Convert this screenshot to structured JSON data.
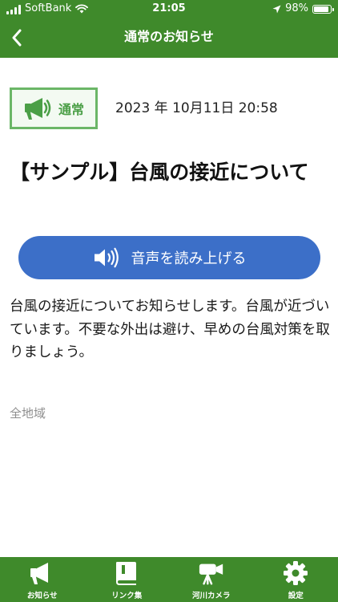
{
  "status_bar": {
    "carrier": "SoftBank",
    "time": "21:05",
    "battery": "98%",
    "battery_level": 0.98
  },
  "nav": {
    "back_icon": "chevron-left-icon",
    "title": "通常のお知らせ"
  },
  "notice": {
    "category_icon": "megaphone-icon",
    "category": "通常",
    "datetime": "2023 年 10月11日 20:58",
    "title": "【サンプル】台風の接近について",
    "read_aloud_icon": "speaker-icon",
    "read_aloud_label": "音声を読み上げる",
    "body": "台風の接近についてお知らせします。台風が近づいています。不要な外出は避け、早めの台風対策を取りましょう。",
    "area": "全地域"
  },
  "tabbar": {
    "items": [
      {
        "label": "お知らせ",
        "icon": "megaphone-icon"
      },
      {
        "label": "リンク集",
        "icon": "book-icon"
      },
      {
        "label": "河川カメラ",
        "icon": "video-camera-icon"
      },
      {
        "label": "設定",
        "icon": "gear-icon"
      }
    ]
  },
  "colors": {
    "header": "#3f8a2b",
    "badge_border": "#6bb667",
    "badge_text": "#4b9f47",
    "button": "#3c6fc8",
    "muted_text": "#8e8e8e"
  }
}
